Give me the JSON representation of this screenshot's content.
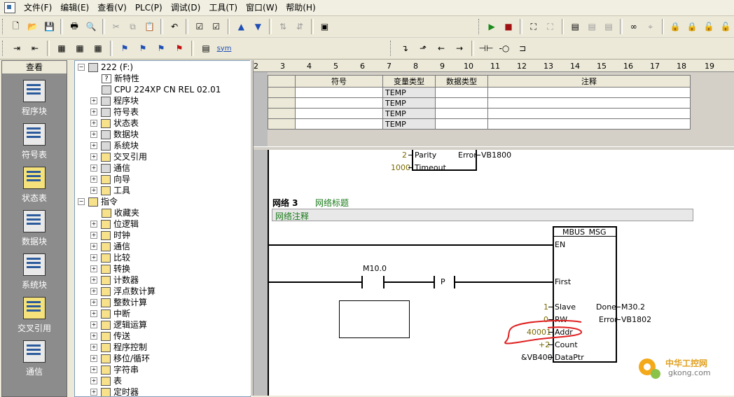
{
  "menu": [
    "文件(F)",
    "编辑(E)",
    "查看(V)",
    "PLC(P)",
    "调试(D)",
    "工具(T)",
    "窗口(W)",
    "帮助(H)"
  ],
  "toolbar2_sym": "sym",
  "viewbar": {
    "title": "查看",
    "items": [
      "程序块",
      "符号表",
      "状态表",
      "数据块",
      "系统块",
      "交叉引用",
      "通信"
    ]
  },
  "tree": {
    "root": "222 (F:)",
    "root_items": [
      "新特性",
      "CPU 224XP CN REL 02.01",
      "程序块",
      "符号表",
      "状态表",
      "数据块",
      "系统块",
      "交叉引用",
      "通信",
      "向导",
      "工具"
    ],
    "instructions_label": "指令",
    "instruction_items": [
      "收藏夹",
      "位逻辑",
      "时钟",
      "通信",
      "比较",
      "转换",
      "计数器",
      "浮点数计算",
      "整数计算",
      "中断",
      "逻辑运算",
      "传送",
      "程序控制",
      "移位/循环",
      "字符串",
      "表",
      "定时器"
    ]
  },
  "ruler": [
    "2",
    "3",
    "4",
    "5",
    "6",
    "7",
    "8",
    "9",
    "10",
    "11",
    "12",
    "13",
    "14",
    "15",
    "16",
    "17",
    "18",
    "19"
  ],
  "var_table": {
    "headers": [
      "符号",
      "变量类型",
      "数据类型",
      "注释"
    ],
    "rows": [
      {
        "type": "TEMP"
      },
      {
        "type": "TEMP"
      },
      {
        "type": "TEMP"
      },
      {
        "type": "TEMP"
      }
    ]
  },
  "ladder": {
    "prev_block": {
      "parity_val": "2",
      "parity_label": "Parity",
      "timeout_val": "1000",
      "timeout_label": "Timeout",
      "error_label": "Error",
      "error_out": "VB1800"
    },
    "network_label": "网络 3",
    "network_title": "网络标题",
    "network_comment": "网络注释",
    "block_name": "MBUS_MSG",
    "en_label": "EN",
    "contact_label": "M10.0",
    "p_label": "P",
    "first_label": "First",
    "slave_val": "1",
    "slave_label": "Slave",
    "rw_val": "0",
    "rw_label": "RW",
    "addr_val": "40001",
    "addr_label": "Addr",
    "count_val": "+2",
    "count_label": "Count",
    "dataptr_val": "&VB400",
    "dataptr_label": "DataPtr",
    "done_label": "Done",
    "done_out": "M30.2",
    "error_label": "Error",
    "error_out": "VB1802"
  },
  "watermark": {
    "cn": "中华工控网",
    "url": "gkong.com"
  },
  "colors": {
    "annotation_red": "#e02020",
    "value_olive": "#7a6a00",
    "title_green": "#1a7a1a"
  }
}
